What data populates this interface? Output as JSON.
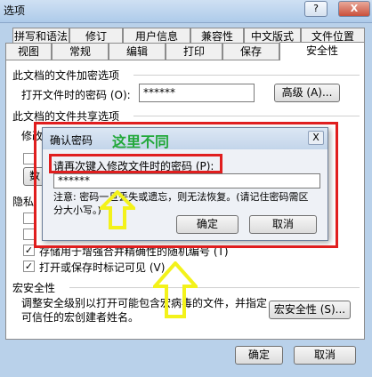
{
  "window": {
    "title": "选项"
  },
  "titlebar_buttons": {
    "help": "?",
    "close": "X"
  },
  "tabs_top": [
    "拼写和语法",
    "修订",
    "用户信息",
    "兼容性",
    "中文版式",
    "文件位置"
  ],
  "tabs_bottom": [
    "视图",
    "常规",
    "编辑",
    "打印",
    "保存",
    "安全性"
  ],
  "encrypt": {
    "section": "此文档的文件加密选项",
    "open_label": "打开文件时的密码 (O):",
    "open_value": "******",
    "advanced_button": "高级 (A)..."
  },
  "share": {
    "section": "此文档的文件共享选项",
    "modify_label_partial": "修改",
    "digital_sig_partial": "数"
  },
  "privacy": {
    "section_partial": "隐私",
    "option3_partial": "存储用于增强合并精确性的随机编号 (T)",
    "option4": "打开或保存时标记可见 (V)"
  },
  "macro": {
    "section": "宏安全性",
    "desc": "调整安全级别以打开可能包含宏病毒的文件，并指定可信任的宏创建者姓名。",
    "button": "宏安全性 (S)..."
  },
  "footer": {
    "ok": "确定",
    "cancel": "取消"
  },
  "dialog": {
    "title": "确认密码",
    "annotation": "这里不同",
    "prompt": "请再次键入修改文件时的密码 (P):",
    "value": "******",
    "note": "注意: 密码一旦丢失或遗忘，则无法恢复。(请记住密码需区分大小写。)",
    "ok": "确定",
    "cancel": "取消",
    "close": "X"
  },
  "colors": {
    "highlight_red": "#e01e1e",
    "annotation_green": "#22a83a",
    "arrow_yellow": "#f3f21a"
  }
}
